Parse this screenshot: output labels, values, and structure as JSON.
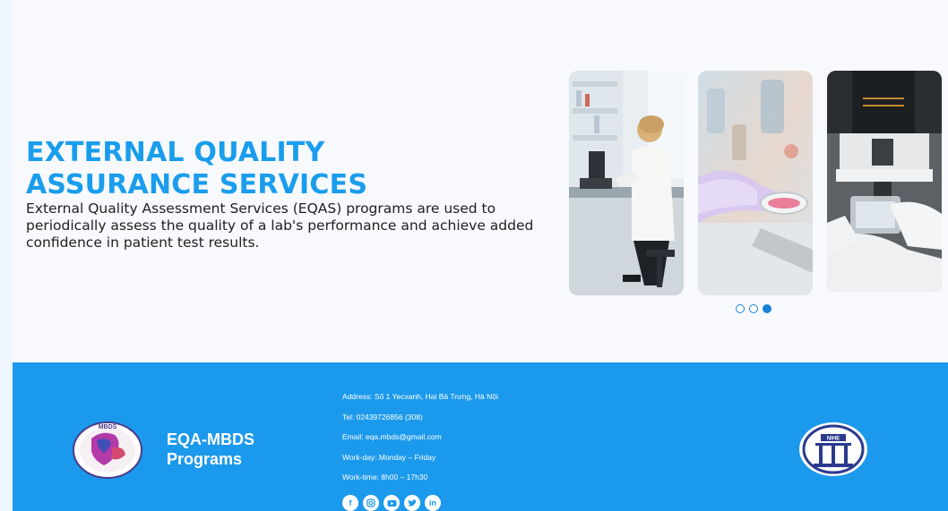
{
  "hero": {
    "title_line1": "EXTERNAL QUALITY",
    "title_line2": "ASSURANCE SERVICES",
    "description": "External Quality Assessment Services (EQAS) programs are used to periodically assess the quality of a lab's performance and achieve added confidence in patient test results."
  },
  "carousel": {
    "images": [
      "scientist-at-microscope",
      "gloved-hand-with-petri-dish",
      "microscope-with-flask"
    ],
    "active_index": 2,
    "dot_count": 3
  },
  "footer": {
    "logo_left_text": "MBDS",
    "brand_line1": "EQA-MBDS",
    "brand_line2": "Programs",
    "address": "Address: Số 1 Yecxanh, Hai Bà Trưng, Hà Nội",
    "tel": "Tel: 02439726856 (308)",
    "email": "Email: eqa.mbds@gmail.com",
    "workday": "Work-day: Monday – Friday",
    "worktime": "Work-time: 8h00 – 17h30",
    "socials": [
      "facebook",
      "instagram",
      "youtube",
      "twitter",
      "linkedin"
    ],
    "logo_right_text": "NIHE"
  },
  "colors": {
    "accent": "#1a9ded",
    "footer_bg": "#1b99ec",
    "dot_active": "#1a7fd6"
  }
}
